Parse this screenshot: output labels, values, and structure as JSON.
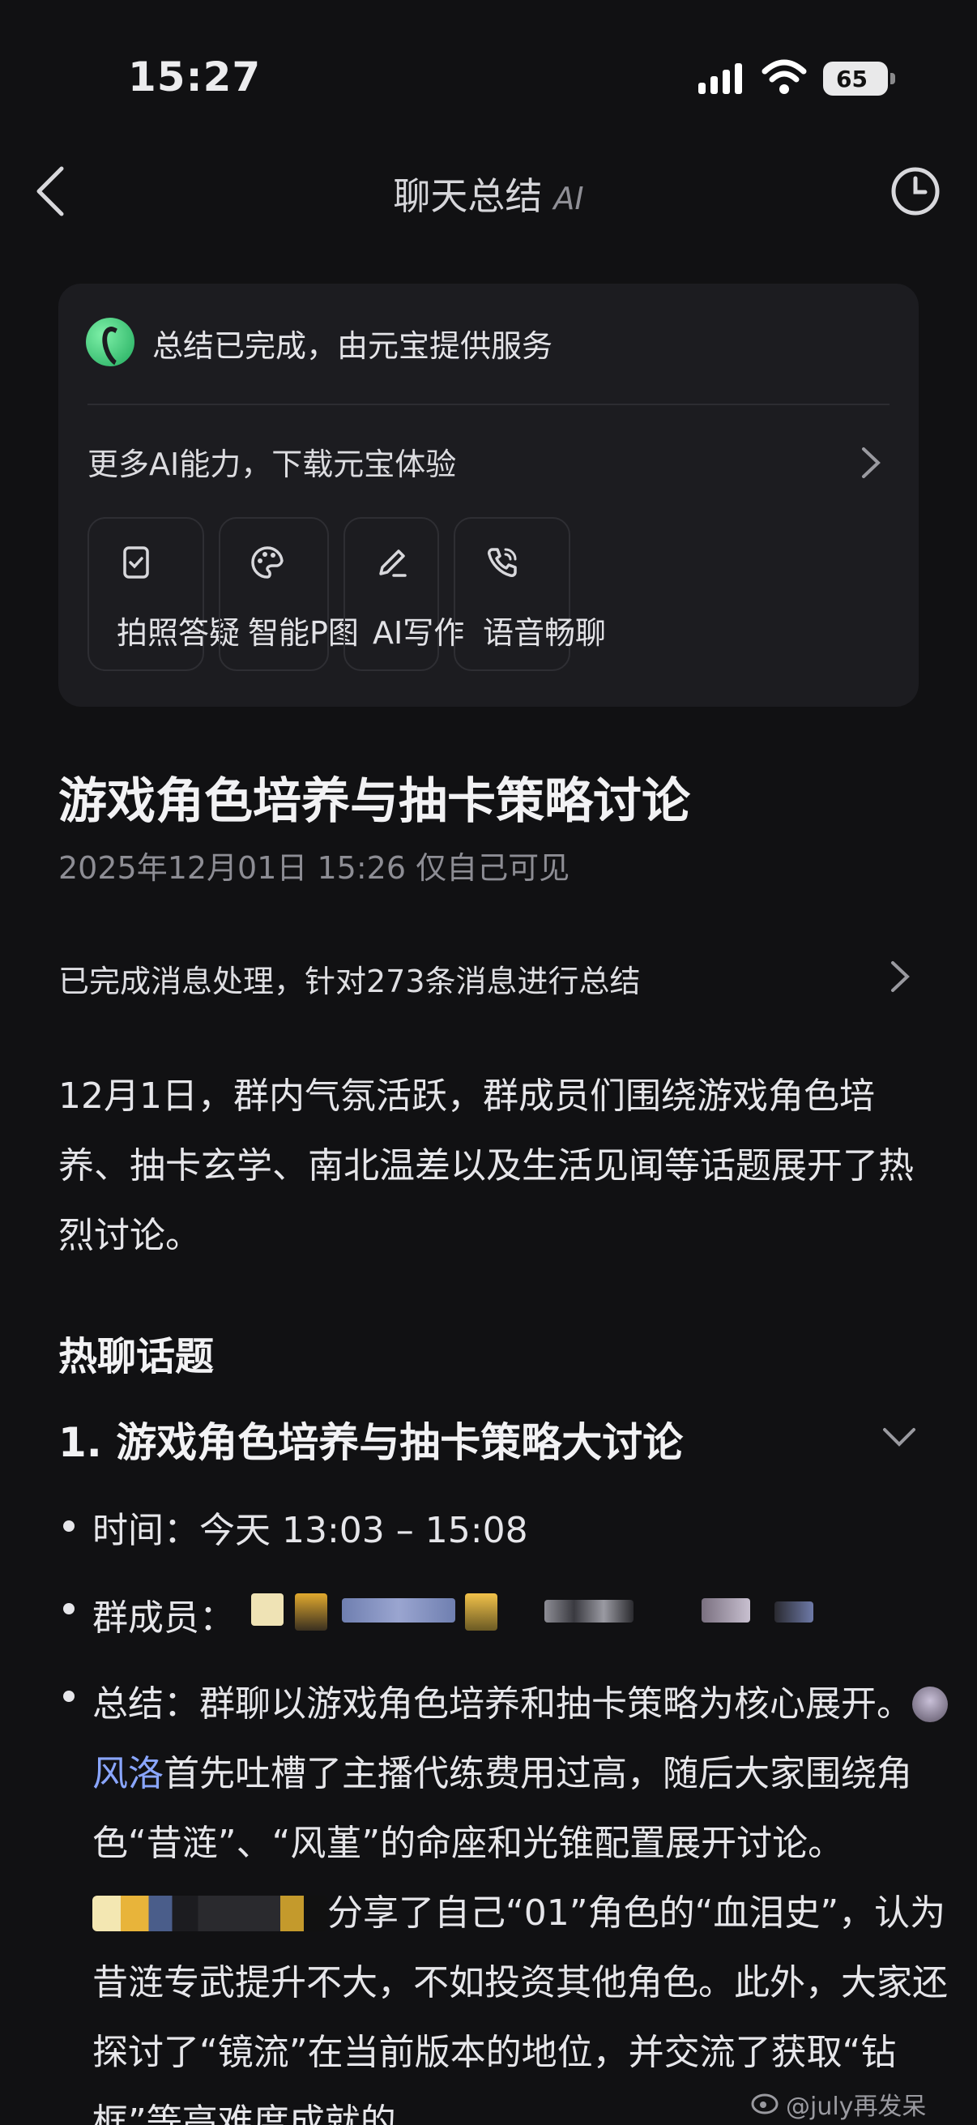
{
  "status": {
    "time": "15:27",
    "battery": "65"
  },
  "nav": {
    "title": "聊天总结",
    "ai_badge": "AI"
  },
  "card": {
    "done_text": "总结已完成，由元宝提供服务",
    "more_ai": "更多AI能力，下载元宝体验",
    "features": [
      {
        "label": "拍照答疑",
        "icon": "photo-qa-icon"
      },
      {
        "label": "智能P图",
        "icon": "palette-icon"
      },
      {
        "label": "AI写作",
        "icon": "pen-icon"
      },
      {
        "label": "语音畅聊",
        "icon": "phone-icon"
      }
    ]
  },
  "summary_page": {
    "title": "游戏角色培养与抽卡策略讨论",
    "meta": "2025年12月01日 15:26 仅自己可见",
    "processed": "已完成消息处理，针对273条消息进行总结",
    "intro": "12月1日，群内气氛活跃，群成员们围绕游戏角色培养、抽卡玄学、南北温差以及生活见闻等话题展开了热烈讨论。",
    "section_title": "热聊话题",
    "topic_title": "1. 游戏角色培养与抽卡策略大讨论",
    "time_line": "时间：今天 13:03 – 15:08",
    "members_label": "群成员：",
    "summary_prefix": "总结：群聊以游戏角色培养和抽卡策略为核心展开。",
    "mention_name": "风洛",
    "summary_part2": "首先吐槽了主播代练费用过高，随后大家围绕角色“昔涟”、“风堇”的命座和光锥配置展开讨论。",
    "summary_part3": "分享了自己“01”角色的“血泪史”，认为昔涟专武提升不大，不如投资其他角色。此外，大家还探讨了“镜流”在当前版本的地位，并交流了获取“钻框”等高难度成就的"
  },
  "watermark": "@july再发呆",
  "colors": {
    "background": "#111113",
    "card": "#1c1c20",
    "mention": "#8aa6ff"
  }
}
